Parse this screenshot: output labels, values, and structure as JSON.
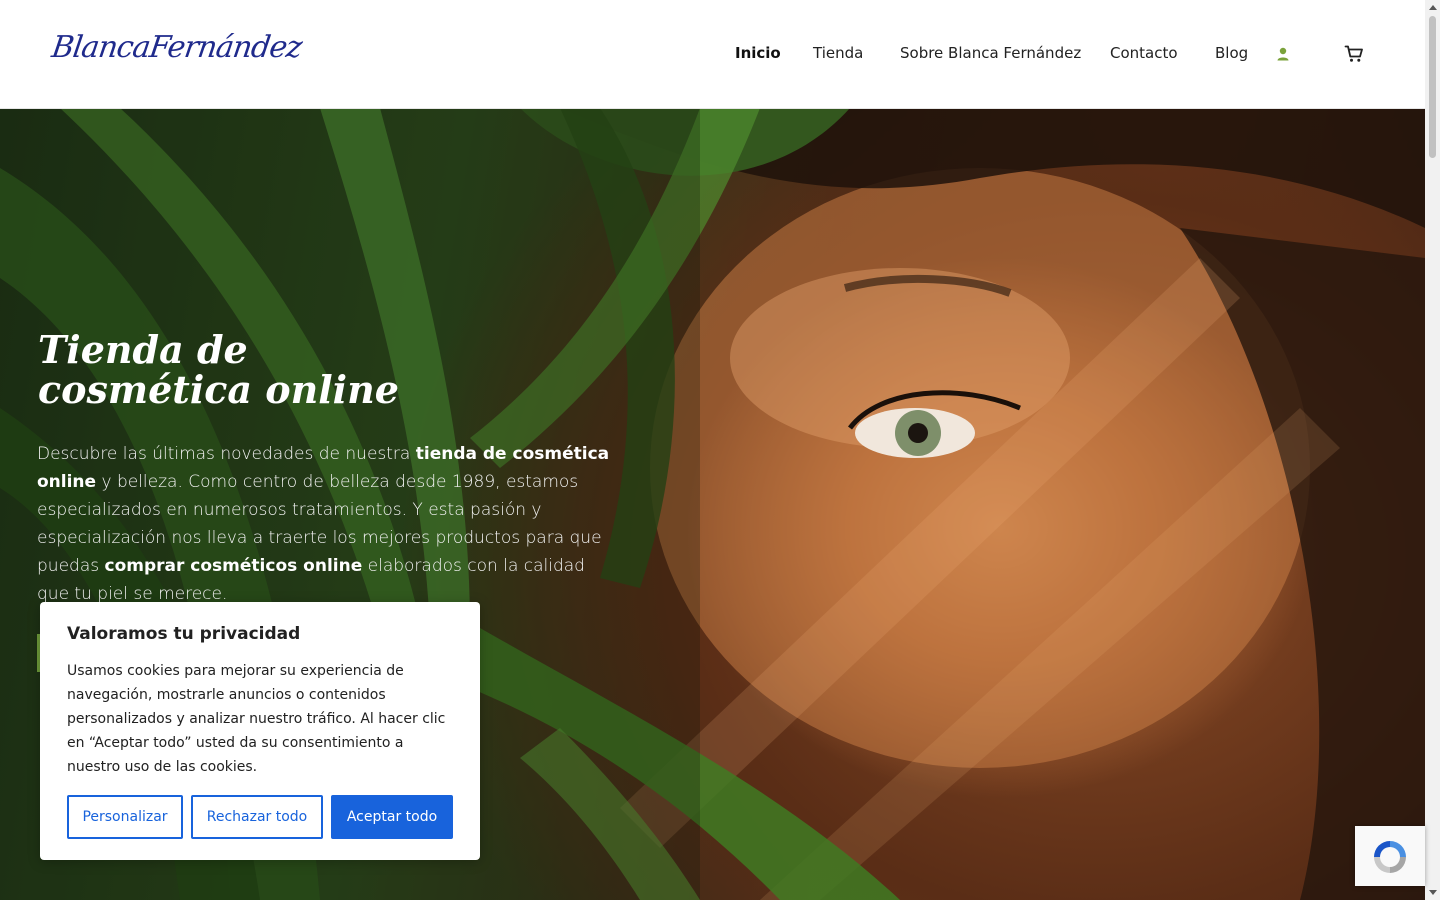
{
  "header": {
    "logo_text": "BlancaFernández",
    "nav": [
      {
        "label": "Inicio",
        "active": true
      },
      {
        "label": "Tienda",
        "active": false
      },
      {
        "label": "Sobre Blanca Fernández",
        "active": false
      },
      {
        "label": "Contacto",
        "active": false
      },
      {
        "label": "Blog",
        "active": false
      }
    ],
    "user_icon": "user-icon",
    "cart_icon": "cart-icon",
    "user_icon_color": "#7aa23a"
  },
  "hero": {
    "title_line1": "Tienda de",
    "title_line2": "cosmética online",
    "text_1": "Descubre las últimas novedades de nuestra ",
    "text_bold_1": "tienda de cosmética online",
    "text_2": " y belleza. Como centro de belleza desde 1989, estamos especializados en numerosos tratamientos. Y esta pasión y especialización nos lleva a traerte los mejores productos para que puedas ",
    "text_bold_2": "comprar cosméticos online",
    "text_3": " elaborados con la calidad que tu piel se merece.",
    "cta_color": "#6e9a3a"
  },
  "cookie_banner": {
    "title": "Valoramos tu privacidad",
    "body": "Usamos cookies para mejorar su experiencia de navegación, mostrarle anuncios o contenidos personalizados y analizar nuestro tráfico. Al hacer clic en “Aceptar todo” usted da su consentimiento a nuestro uso de las cookies.",
    "customize_label": "Personalizar",
    "reject_label": "Rechazar todo",
    "accept_label": "Aceptar todo",
    "accent_color": "#1863dc"
  },
  "recaptcha": {
    "icon": "recaptcha-icon"
  }
}
